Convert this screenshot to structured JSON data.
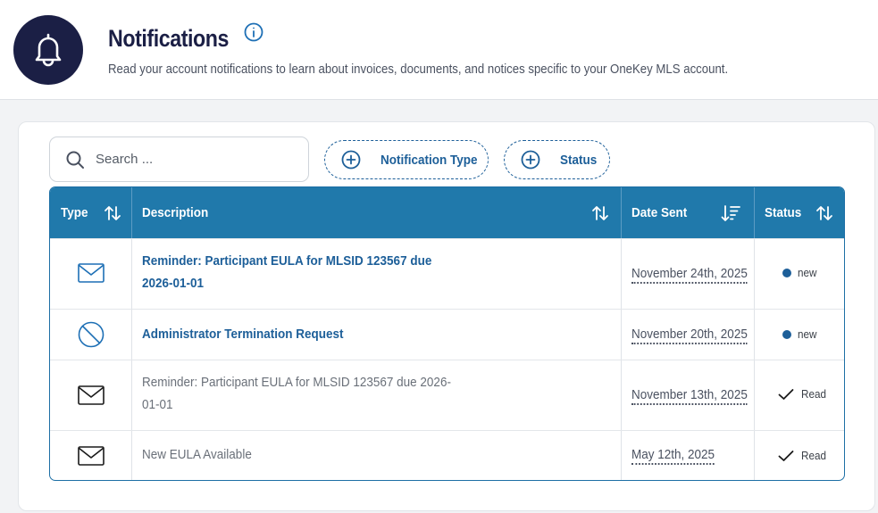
{
  "header": {
    "title": "Notifications",
    "subtitle": "Read your account notifications to learn about invoices, documents, and notices specific to your OneKey MLS account."
  },
  "toolbar": {
    "search_placeholder": "Search ...",
    "filter_type_label": "Notification Type",
    "filter_status_label": "Status"
  },
  "table": {
    "columns": {
      "type": "Type",
      "description": "Description",
      "date_sent": "Date Sent",
      "status": "Status"
    },
    "rows": [
      {
        "icon": "envelope-icon",
        "description": "Reminder: Participant EULA for MLSID 123567 due 2026-01-01",
        "date": "November 24th, 2025",
        "status": "new"
      },
      {
        "icon": "prohibited-icon",
        "description": "Administrator Termination Request",
        "date": "November 20th, 2025",
        "status": "new"
      },
      {
        "icon": "envelope-icon",
        "description": "Reminder: Participant EULA for MLSID 123567 due 2026-01-01",
        "date": "November 13th, 2025",
        "status": "Read"
      },
      {
        "icon": "envelope-icon",
        "description": "New EULA Available",
        "date": "May 12th, 2025",
        "status": "Read"
      }
    ]
  },
  "colors": {
    "header_blue": "#2079ab",
    "link_blue": "#1d5f99",
    "navy": "#1b1f45"
  }
}
